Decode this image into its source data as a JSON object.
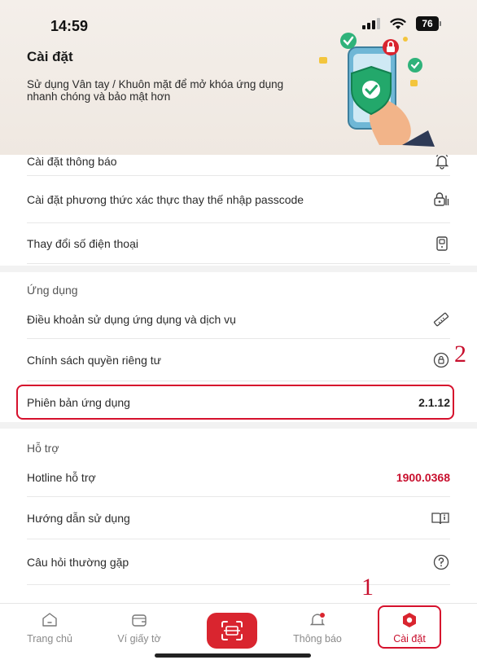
{
  "status_bar": {
    "time": "14:59",
    "battery": "76"
  },
  "header": {
    "title": "Cài đặt",
    "description": "Sử dụng Vân tay / Khuôn mặt để mở khóa ứng dụng nhanh chóng và bảo mật hơn"
  },
  "security": {
    "items": [
      {
        "label": "Cài đặt thông báo",
        "icon": "bell-icon"
      },
      {
        "label": "Cài đặt phương thức xác thực thay thế nhập passcode",
        "icon": "auth-method-icon"
      },
      {
        "label": "Thay đổi số điện thoại",
        "icon": "phone-icon"
      }
    ]
  },
  "app_section": {
    "title": "Ứng dụng",
    "items": [
      {
        "label": "Điều khoản sử dụng ứng dụng và dịch vụ",
        "icon": "ruler-icon"
      },
      {
        "label": "Chính sách quyền riêng tư",
        "icon": "privacy-icon"
      },
      {
        "label": "Phiên bản ứng dụng",
        "value": "2.1.12"
      }
    ]
  },
  "support_section": {
    "title": "Hỗ trợ",
    "items": [
      {
        "label": "Hotline hỗ trợ",
        "value": "1900.0368"
      },
      {
        "label": "Hướng dẫn sử dụng",
        "icon": "book-icon"
      },
      {
        "label": "Câu hỏi thường gặp",
        "icon": "question-icon"
      }
    ]
  },
  "annotations": {
    "one": "1",
    "two": "2"
  },
  "bottom_nav": {
    "items": [
      {
        "label": "Trang chủ",
        "icon": "home-icon"
      },
      {
        "label": "Ví giấy tờ",
        "icon": "wallet-icon"
      },
      {
        "label": "",
        "icon": "scan-icon"
      },
      {
        "label": "Thông báo",
        "icon": "notification-icon"
      },
      {
        "label": "Cài đặt",
        "icon": "settings-icon",
        "active": true
      }
    ]
  },
  "colors": {
    "accent": "#c8102e",
    "header_bg": "#f1ebe5",
    "scan_bg": "#d9252f"
  }
}
